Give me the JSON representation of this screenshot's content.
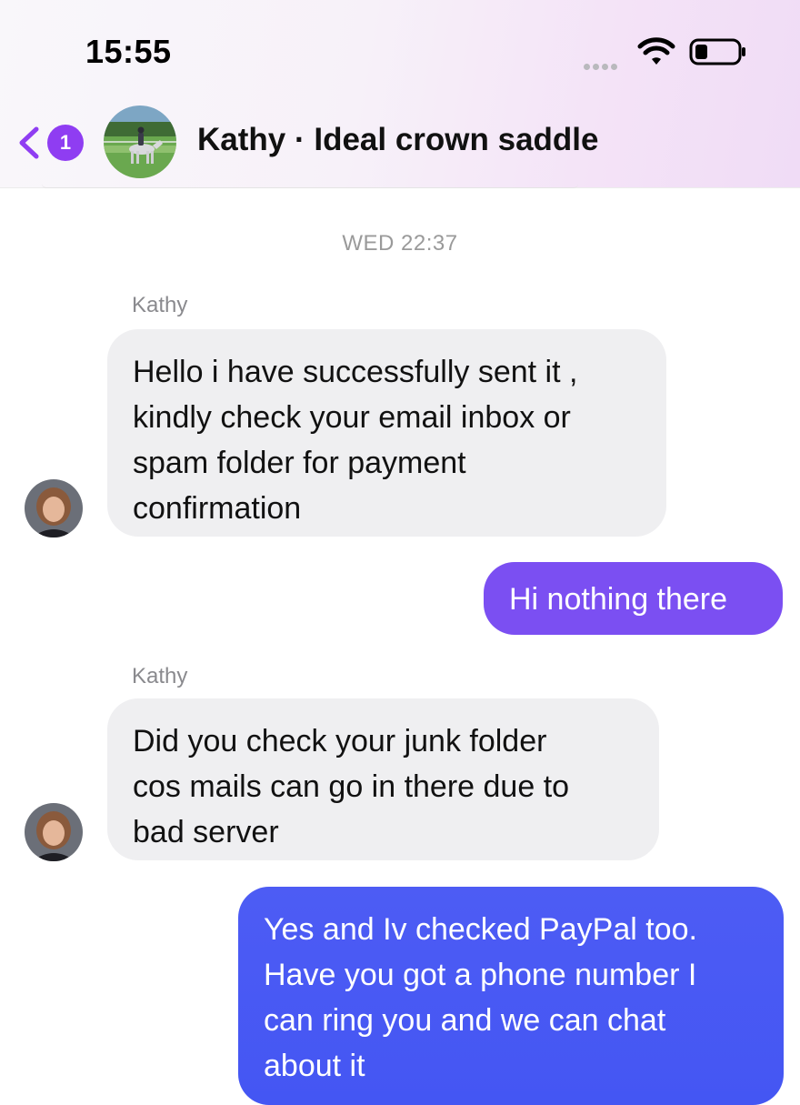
{
  "status_bar": {
    "time": "15:55",
    "signal": "signal-dots-icon",
    "wifi": "wifi-icon",
    "battery": "battery-icon"
  },
  "header": {
    "back_badge_count": "1",
    "title": "Kathy · Ideal crown saddle",
    "accent_color": "#8f3df2"
  },
  "conversation": {
    "timestamp": "WED 22:37",
    "messages": [
      {
        "direction": "incoming",
        "sender": "Kathy",
        "lines": [
          "Hello i have successfully sent it ,",
          "kindly check your email inbox or",
          "spam folder for payment",
          "confirmation"
        ]
      },
      {
        "direction": "outgoing",
        "lines": [
          "Hi nothing there"
        ],
        "color": "#7b4ff2"
      },
      {
        "direction": "incoming",
        "sender": "Kathy",
        "lines": [
          "Did you check your junk folder",
          "cos mails can go in there due to",
          "bad server"
        ]
      },
      {
        "direction": "outgoing",
        "lines": [
          "Yes and Iv checked PayPal too.",
          "Have you got a phone number I",
          "can ring you and we can chat",
          "about it"
        ],
        "color": "#4a5af5"
      }
    ]
  }
}
